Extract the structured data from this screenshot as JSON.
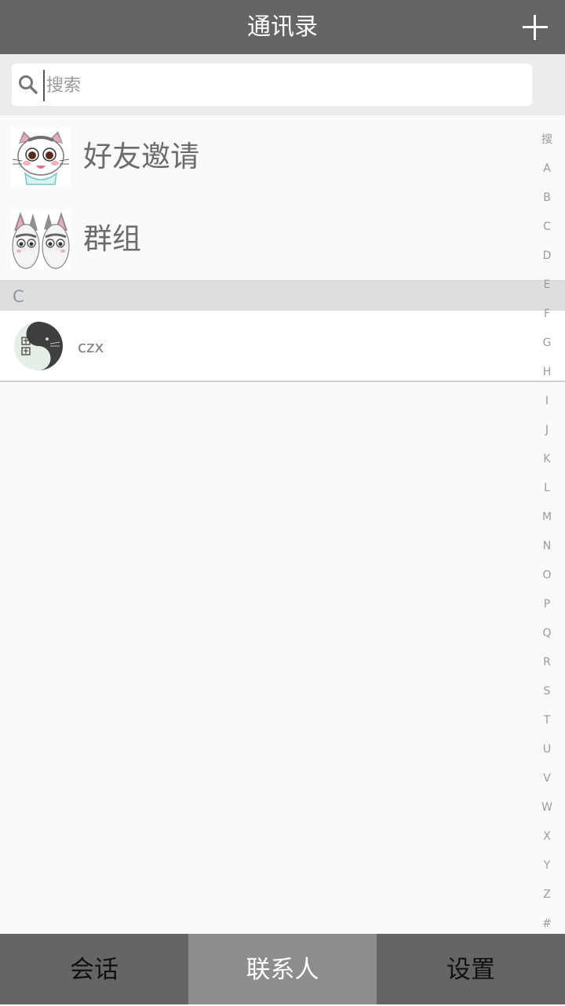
{
  "header": {
    "title": "通讯录",
    "add_icon": "plus-icon"
  },
  "search": {
    "placeholder": "搜索",
    "value": "",
    "icon": "search-icon"
  },
  "special_rows": [
    {
      "label": "好友邀请",
      "icon": "cat-avatar-icon"
    },
    {
      "label": "群组",
      "icon": "cat-pair-avatar-icon"
    }
  ],
  "sections": [
    {
      "letter": "C",
      "contacts": [
        {
          "name": "czx",
          "avatar": "yin-yang-cat-avatar-icon"
        }
      ]
    }
  ],
  "index_bar": [
    "搜",
    "A",
    "B",
    "C",
    "D",
    "E",
    "F",
    "G",
    "H",
    "I",
    "J",
    "K",
    "L",
    "M",
    "N",
    "O",
    "P",
    "Q",
    "R",
    "S",
    "T",
    "U",
    "V",
    "W",
    "X",
    "Y",
    "Z",
    "#"
  ],
  "tabs": [
    {
      "label": "会话",
      "active": false
    },
    {
      "label": "联系人",
      "active": true
    },
    {
      "label": "设置",
      "active": false
    }
  ],
  "colors": {
    "header_bg": "#656565",
    "active_tab_bg": "#8d8d8d",
    "section_bg": "#dedede",
    "page_bg": "#fafafa"
  }
}
